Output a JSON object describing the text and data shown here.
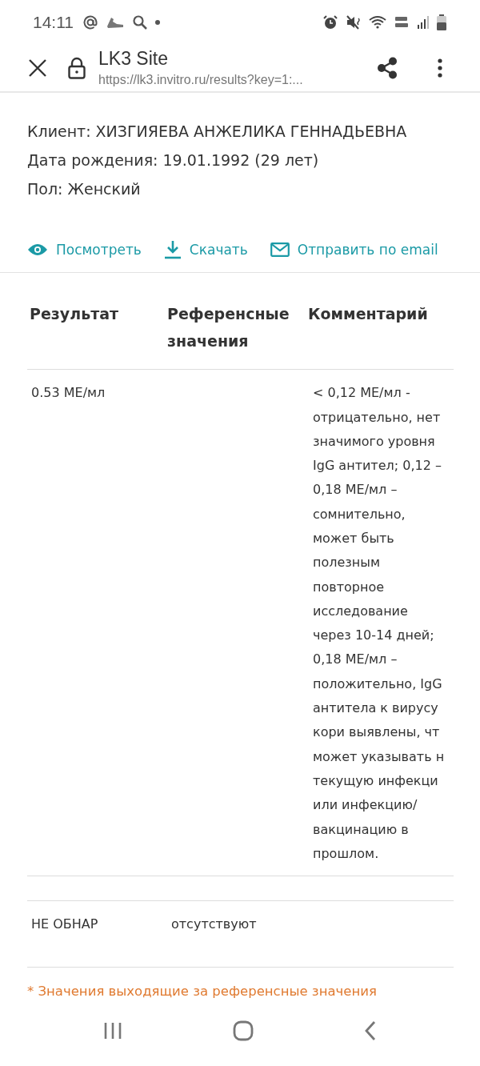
{
  "status_bar": {
    "time": "14:11"
  },
  "toolbar": {
    "title": "LK3 Site",
    "url": "https://lk3.invitro.ru/results?key=1:..."
  },
  "client": [
    "Клиент: ХИЗГИЯЕВА АНЖЕЛИКА ГЕННАДЬЕВНА",
    "Дата рождения: 19.01.1992 (29 лет)",
    "Пол: Женский"
  ],
  "actions": [
    {
      "kind": "view",
      "label": "Посмотреть"
    },
    {
      "kind": "download",
      "label": "Скачать"
    },
    {
      "kind": "email",
      "label": "Отправить по email"
    }
  ],
  "table": {
    "columns": [
      "Результат",
      "Референсные значения",
      "Комментарий"
    ],
    "rows": [
      {
        "result": "0.53 МЕ/мл",
        "comment": [
          "< 0,12 МЕ/мл -",
          "отрицательно, нет",
          "значимого уровня",
          "IgG антител; 0,12 –",
          "0,18 МЕ/мл –",
          "сомнительно,",
          "может быть",
          "полезным",
          "повторное",
          "исследование",
          "через 10-14 дней;",
          "0,18 МЕ/мл –",
          "положительно, IgG",
          "антитела к вирусу",
          "кори выявлены, чт",
          "может указывать н",
          "текущую инфекци",
          "или инфекцию/",
          "вакцинацию в",
          "прошлом."
        ]
      },
      {
        "result": "НЕ ОБНАР",
        "reference": "отсутствуют"
      }
    ]
  },
  "footnote": "* Значения выходящие за референсные значения"
}
